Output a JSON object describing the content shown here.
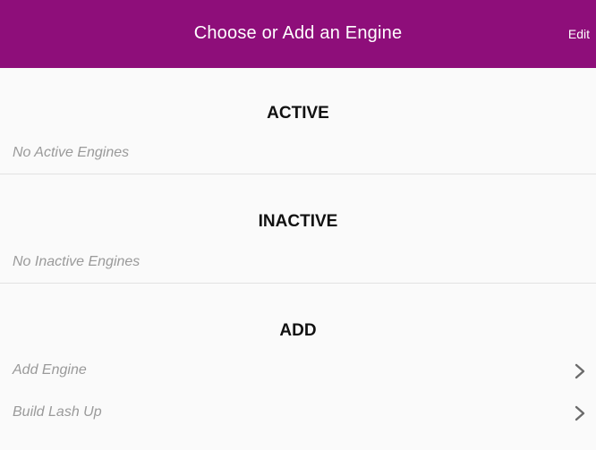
{
  "navbar": {
    "title": "Choose or Add an Engine",
    "edit_label": "Edit",
    "background_color": "#8e0e7a"
  },
  "sections": {
    "active": {
      "title": "ACTIVE",
      "empty_text": "No Active Engines"
    },
    "inactive": {
      "title": "INACTIVE",
      "empty_text": "No Inactive Engines"
    },
    "add": {
      "title": "ADD",
      "items": [
        {
          "label": "Add Engine",
          "icon": "chevron-right-icon"
        },
        {
          "label": "Build Lash Up",
          "icon": "chevron-right-icon"
        }
      ]
    }
  }
}
